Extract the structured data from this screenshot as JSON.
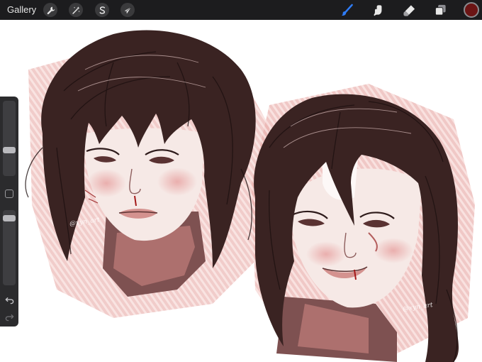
{
  "toolbar": {
    "gallery_label": "Gallery",
    "left_tools": [
      {
        "name": "actions",
        "icon": "wrench-icon"
      },
      {
        "name": "adjustments",
        "icon": "magic-wand-icon"
      },
      {
        "name": "selection",
        "icon": "selection-s-icon"
      },
      {
        "name": "transform",
        "icon": "arrow-cursor-icon"
      }
    ],
    "right_tools": [
      {
        "name": "brush",
        "icon": "brush-icon",
        "active": true
      },
      {
        "name": "smudge",
        "icon": "smudge-finger-icon",
        "active": false
      },
      {
        "name": "eraser",
        "icon": "eraser-icon",
        "active": false
      },
      {
        "name": "layers",
        "icon": "layers-icon",
        "active": false
      }
    ],
    "current_color": "#6b1414"
  },
  "sidebar": {
    "brush_size": 0.32,
    "opacity": 0.95,
    "undo_icon": "undo-arrow-icon",
    "redo_icon": "redo-arrow-icon"
  },
  "canvas": {
    "artwork": "two portrait sketches",
    "signatures": [
      "@xyn_art",
      "@xyn_art"
    ]
  },
  "colors": {
    "accent": "#2f7cf6",
    "toolbar_bg": "#1c1c1e",
    "sidebar_bg": "#2b2b2d",
    "hair": "#3a2322",
    "skin_shadow": "#d98e8e",
    "pink_wash": "#e7a3a0"
  }
}
